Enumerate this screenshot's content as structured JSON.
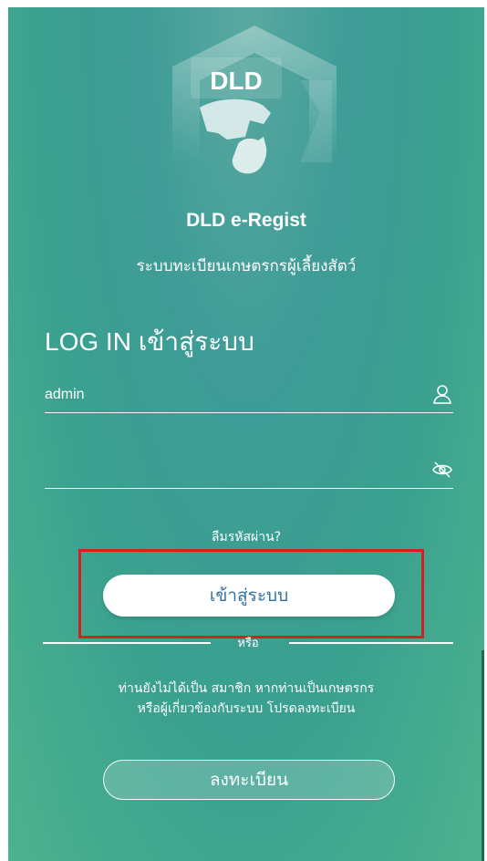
{
  "logo": {
    "text": "DLD"
  },
  "app": {
    "title": "DLD e-Regist",
    "subtitle": "ระบบทะเบียนเกษตรกรผู้เลี้ยงสัตว์"
  },
  "login": {
    "heading": "LOG IN เข้าสู่ระบบ",
    "username_value": "admin",
    "password_value": "",
    "forgot_label": "ลืมรหัสผ่าน?",
    "submit_label": "เข้าสู่ระบบ"
  },
  "divider": {
    "or_label": "หรือ"
  },
  "register": {
    "info_line1": "ท่านยังไม่ได้เป็น สมาชิก หากท่านเป็นเกษตรกร",
    "info_line2": "หรือผู้เกี่ยวข้องกับระบบ โปรดลงทะเบียน",
    "button_label": "ลงทะเบียน"
  },
  "icons": {
    "username": "user-icon",
    "password": "eye-off-icon"
  },
  "colors": {
    "background": "#3f9c97",
    "button_text": "#2f6fa6",
    "highlight": "#d62020"
  }
}
